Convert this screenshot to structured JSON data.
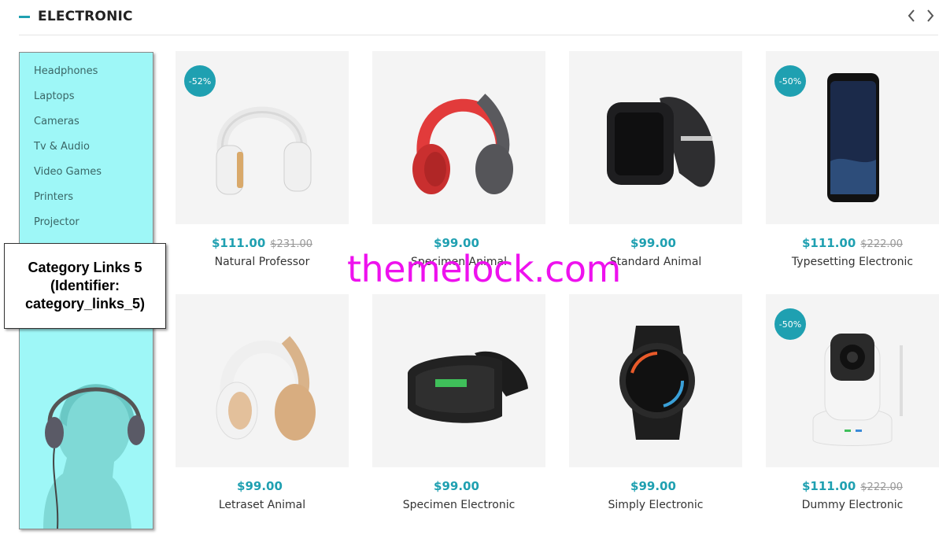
{
  "section": {
    "title": "ELECTRONIC"
  },
  "sidebar": {
    "categories": [
      "Headphones",
      "Laptops",
      "Cameras",
      "Tv & Audio",
      "Video Games",
      "Printers",
      "Projector"
    ]
  },
  "annotation": {
    "text": "Category Links 5 (Identifier: category_links_5)"
  },
  "products": [
    {
      "name": "Natural Professor",
      "price": "$111.00",
      "old_price": "$231.00",
      "badge": "-52%"
    },
    {
      "name": "Specimen Animal",
      "price": "$99.00",
      "old_price": "",
      "badge": ""
    },
    {
      "name": "Standard Animal",
      "price": "$99.00",
      "old_price": "",
      "badge": ""
    },
    {
      "name": "Typesetting Electronic",
      "price": "$111.00",
      "old_price": "$222.00",
      "badge": "-50%"
    },
    {
      "name": "Letraset Animal",
      "price": "$99.00",
      "old_price": "",
      "badge": ""
    },
    {
      "name": "Specimen Electronic",
      "price": "$99.00",
      "old_price": "",
      "badge": ""
    },
    {
      "name": "Simply Electronic",
      "price": "$99.00",
      "old_price": "",
      "badge": ""
    },
    {
      "name": "Dummy Electronic",
      "price": "$111.00",
      "old_price": "$222.00",
      "badge": "-50%"
    }
  ],
  "watermark": "themelock.com",
  "colors": {
    "accent": "#1fa0b1",
    "sidebar_bg": "#9ef7f7",
    "watermark": "#ee11ee"
  },
  "icons": [
    "chevron-left-icon",
    "chevron-right-icon"
  ]
}
